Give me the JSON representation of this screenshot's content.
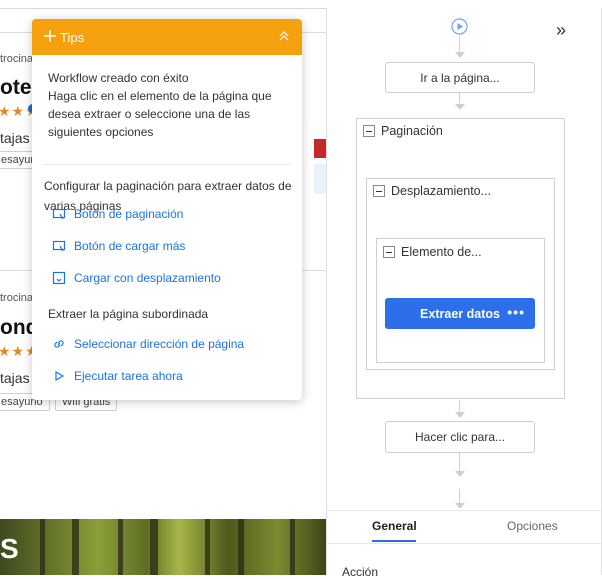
{
  "tips": {
    "title": "Tips",
    "message": "Workflow creado con éxito\nHaga clic en el elemento de la página que desea extraer o seleccione una de las siguientes opciones",
    "pagination_section": "Configurar la paginación para extraer datos de varias páginas",
    "pagination_options": [
      {
        "label": "Botón de paginación",
        "icon": "pagination-button-icon"
      },
      {
        "label": "Botón de cargar más",
        "icon": "load-more-icon"
      },
      {
        "label": "Cargar con desplazamiento",
        "icon": "scroll-load-icon"
      }
    ],
    "subpage_section": "Extraer la página subordinada",
    "subpage_options": [
      {
        "label": "Seleccionar dirección de página",
        "icon": "link-icon"
      },
      {
        "label": "Ejecutar tarea ahora",
        "icon": "play-icon"
      }
    ]
  },
  "page": {
    "card1": {
      "sponsor": "trocina",
      "name": "otel",
      "stars": "★★★",
      "ventajas": "tajas",
      "chip": "esayuno"
    },
    "card2": {
      "sponsor": "trocina",
      "name": "onde",
      "stars": "★★★",
      "ventajas": "tajas",
      "chips": [
        "esayuno",
        "Wifi gratis"
      ]
    },
    "banner_letter": "S"
  },
  "workflow": {
    "nodes": {
      "go_to_page": "Ir a la página...",
      "pagination": "Paginación",
      "scroll": "Desplazamiento...",
      "element": "Elemento de...",
      "extract": "Extraer datos",
      "click": "Hacer clic para..."
    },
    "more_glyph": "•••",
    "collapse_glyph": "»"
  },
  "tabs": [
    {
      "label": "General",
      "active": true
    },
    {
      "label": "Opciones",
      "active": false
    }
  ],
  "accion_label": "Acción",
  "colors": {
    "tips_header": "#f5a00d",
    "accent": "#2d6fea",
    "link": "#1a73e8"
  }
}
